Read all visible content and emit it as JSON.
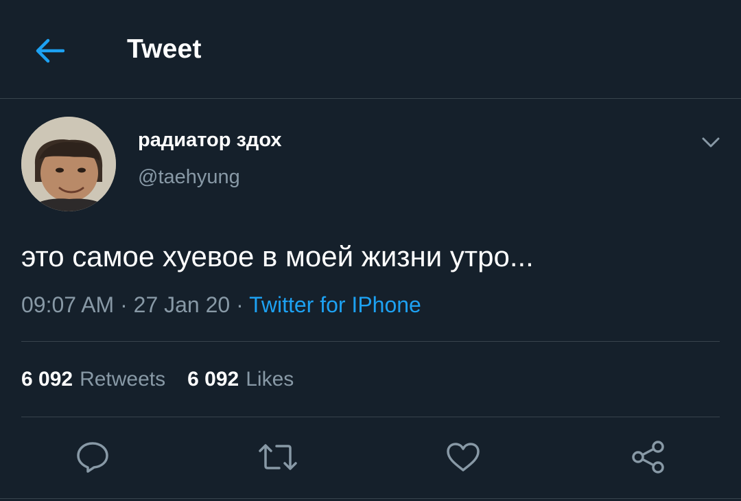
{
  "header": {
    "title": "Tweet",
    "back_icon": "arrow-left-icon"
  },
  "author": {
    "display_name": "радиатор здох",
    "handle": "@taehyung"
  },
  "tweet": {
    "text": "это самое хуевое в моей жизни утро...",
    "time": "09:07 AM",
    "separator": " · ",
    "date": "27 Jan 20",
    "source": "Twitter for IPhone"
  },
  "stats": {
    "retweets_count": "6 092",
    "retweets_label": "Retweets",
    "likes_count": "6 092",
    "likes_label": "Likes"
  },
  "actions": [
    "reply-icon",
    "retweet-icon",
    "like-icon",
    "share-icon"
  ],
  "colors": {
    "background": "#15202b",
    "accent": "#1da1f2",
    "muted": "#8899a6",
    "border": "#38444d"
  }
}
